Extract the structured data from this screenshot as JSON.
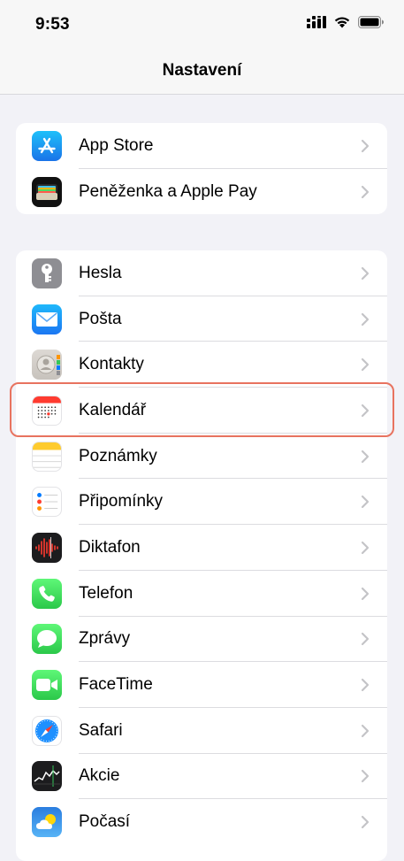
{
  "status": {
    "time": "9:53"
  },
  "nav": {
    "title": "Nastavení"
  },
  "group1": [
    {
      "label": "App Store",
      "icon": "app-store-icon"
    },
    {
      "label": "Peněženka a Apple Pay",
      "icon": "wallet-icon"
    }
  ],
  "group2": [
    {
      "label": "Hesla",
      "icon": "key-icon"
    },
    {
      "label": "Pošta",
      "icon": "mail-icon"
    },
    {
      "label": "Kontakty",
      "icon": "contacts-icon"
    },
    {
      "label": "Kalendář",
      "icon": "calendar-icon"
    },
    {
      "label": "Poznámky",
      "icon": "notes-icon"
    },
    {
      "label": "Připomínky",
      "icon": "reminders-icon"
    },
    {
      "label": "Diktafon",
      "icon": "voice-memos-icon"
    },
    {
      "label": "Telefon",
      "icon": "phone-icon"
    },
    {
      "label": "Zprávy",
      "icon": "messages-icon"
    },
    {
      "label": "FaceTime",
      "icon": "facetime-icon"
    },
    {
      "label": "Safari",
      "icon": "safari-icon"
    },
    {
      "label": "Akcie",
      "icon": "stocks-icon"
    },
    {
      "label": "Počasí",
      "icon": "weather-icon"
    }
  ],
  "colors": {
    "highlight": "#e8735f",
    "background": "#f2f2f7"
  }
}
